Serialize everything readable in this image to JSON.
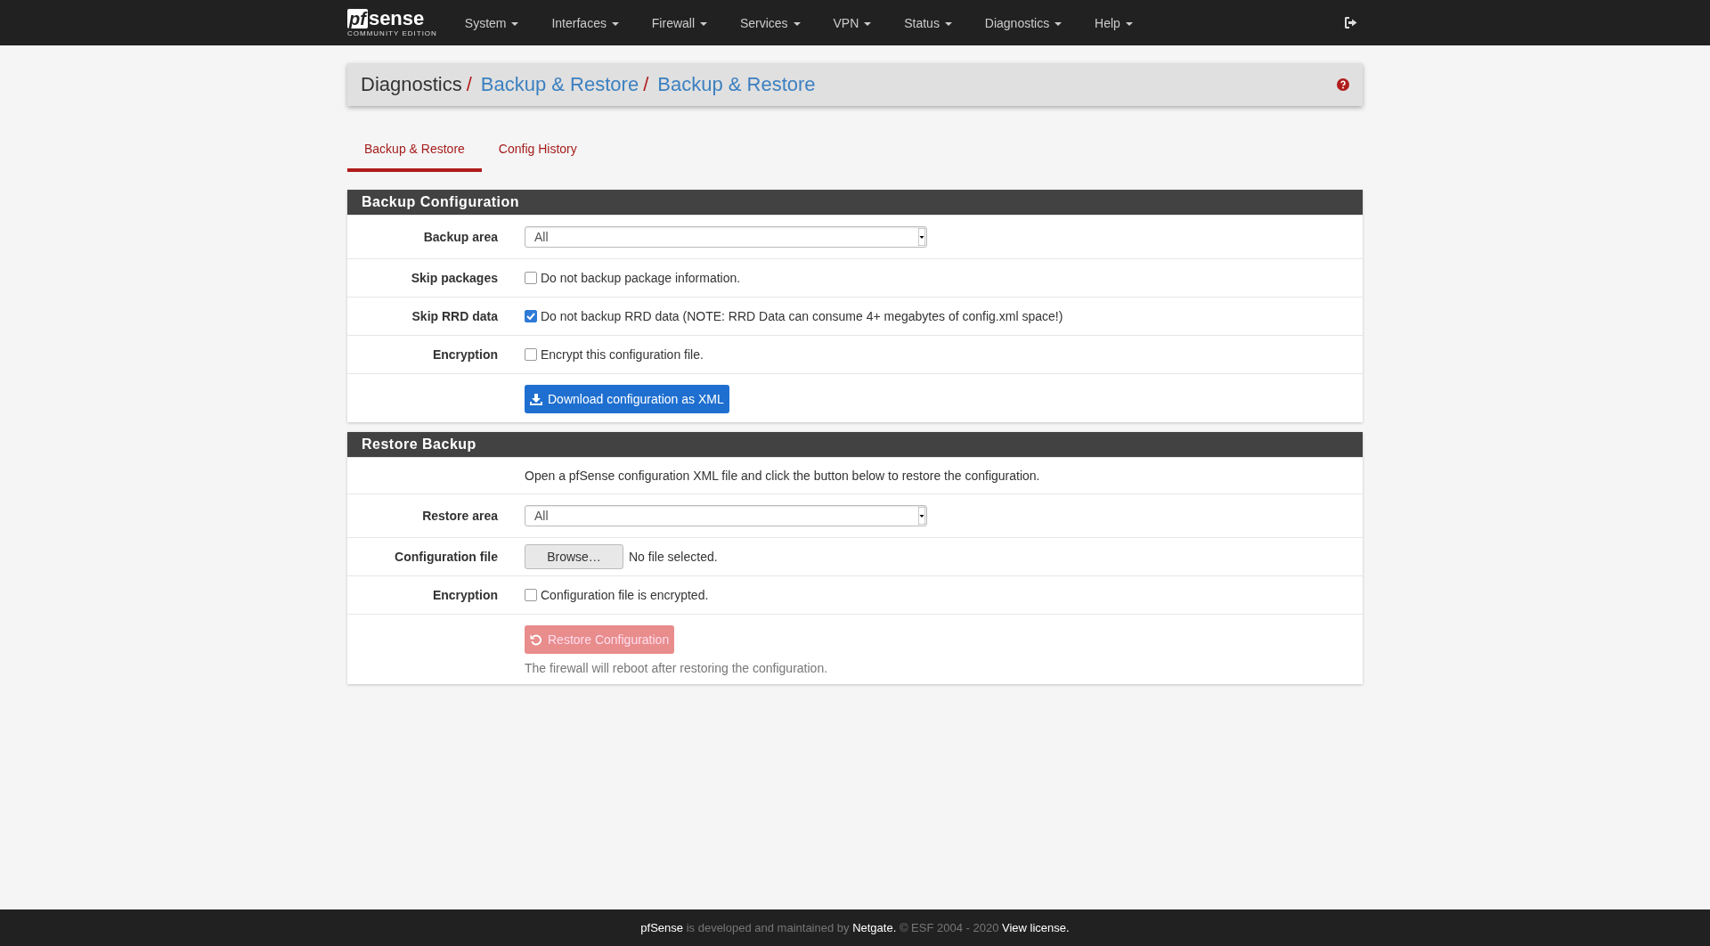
{
  "navbar": {
    "logo": {
      "mark": "pf",
      "word": "sense",
      "edition": "COMMUNITY EDITION"
    },
    "menus": [
      {
        "label": "System"
      },
      {
        "label": "Interfaces"
      },
      {
        "label": "Firewall"
      },
      {
        "label": "Services"
      },
      {
        "label": "VPN"
      },
      {
        "label": "Status"
      },
      {
        "label": "Diagnostics"
      },
      {
        "label": "Help"
      }
    ]
  },
  "breadcrumb": {
    "separator": "/",
    "items": [
      {
        "label": "Diagnostics",
        "link": false
      },
      {
        "label": "Backup & Restore",
        "link": true
      },
      {
        "label": "Backup & Restore",
        "link": true
      }
    ]
  },
  "tabs": [
    {
      "label": "Backup & Restore",
      "selected": true
    },
    {
      "label": "Config History",
      "selected": false
    }
  ],
  "panels": [
    {
      "title": "Backup Configuration",
      "rows": [
        {
          "kind": "select",
          "label": "Backup area",
          "value": "All"
        },
        {
          "kind": "checkbox",
          "label": "Skip packages",
          "text": "Do not backup package information.",
          "checked": false
        },
        {
          "kind": "checkbox",
          "label": "Skip RRD data",
          "text": "Do not backup RRD data (NOTE: RRD Data can consume 4+ megabytes of config.xml space!)",
          "checked": true
        },
        {
          "kind": "checkbox",
          "label": "Encryption",
          "text": "Encrypt this configuration file.",
          "checked": false
        },
        {
          "kind": "button",
          "text": "Download configuration as XML",
          "disabled": false
        }
      ]
    },
    {
      "title": "Restore Backup",
      "rows": [
        {
          "kind": "text",
          "text": "Open a pfSense configuration XML file and click the button below to restore the configuration."
        },
        {
          "kind": "select",
          "label": "Restore area",
          "value": "All"
        },
        {
          "kind": "file",
          "label": "Configuration file",
          "button": "Browse…",
          "status": "No file selected."
        },
        {
          "kind": "checkbox",
          "label": "Encryption",
          "text": "Configuration file is encrypted.",
          "checked": false
        },
        {
          "kind": "button",
          "text": "Restore Configuration",
          "disabled": true,
          "help": "The firewall will reboot after restoring the configuration."
        }
      ]
    }
  ],
  "footer": [
    {
      "kind": "link",
      "text": "pfSense"
    },
    {
      "kind": "text",
      "text": " is developed and maintained by "
    },
    {
      "kind": "link",
      "text": "Netgate."
    },
    {
      "kind": "text",
      "text": " © ESF 2004 - 2020 "
    },
    {
      "kind": "link",
      "text": "View license."
    }
  ]
}
